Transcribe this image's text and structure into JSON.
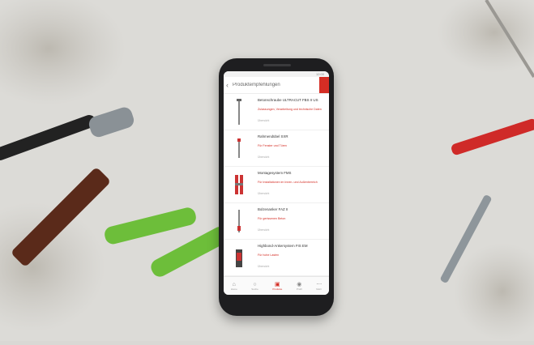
{
  "screen": {
    "title": "Produktempfehlungen",
    "status_time": "12:00",
    "accent_color": "#d42d24",
    "items": [
      {
        "name": "Betonschraube ULTRACUT FBS II US",
        "desc": "Zulassungen, Verarbeitung und technische Daten",
        "sub": "Übersicht",
        "thumb": "screw-anchor"
      },
      {
        "name": "Rahmendübel SXR",
        "desc": "Für Fenster und Türen",
        "sub": "Übersicht",
        "thumb": "frame-anchor"
      },
      {
        "name": "Montagesystem FMS",
        "desc": "Für Installationen im Innen- und Außenbereich",
        "sub": "Übersicht",
        "thumb": "mounting-system"
      },
      {
        "name": "Bolzenanker FAZ II",
        "desc": "Für gerissenen Beton",
        "sub": "Übersicht",
        "thumb": "bolt-anchor"
      },
      {
        "name": "Highbond-Ankersystem FIS EM",
        "desc": "Für hohe Lasten",
        "sub": "Übersicht",
        "thumb": "chemical-anchor"
      }
    ],
    "nav": [
      {
        "label": "Home",
        "icon": "home-icon"
      },
      {
        "label": "Suche",
        "icon": "search-icon"
      },
      {
        "label": "Produkte",
        "icon": "products-icon",
        "active": true
      },
      {
        "label": "Profil",
        "icon": "profile-icon"
      },
      {
        "label": "Mehr",
        "icon": "more-icon"
      }
    ]
  }
}
